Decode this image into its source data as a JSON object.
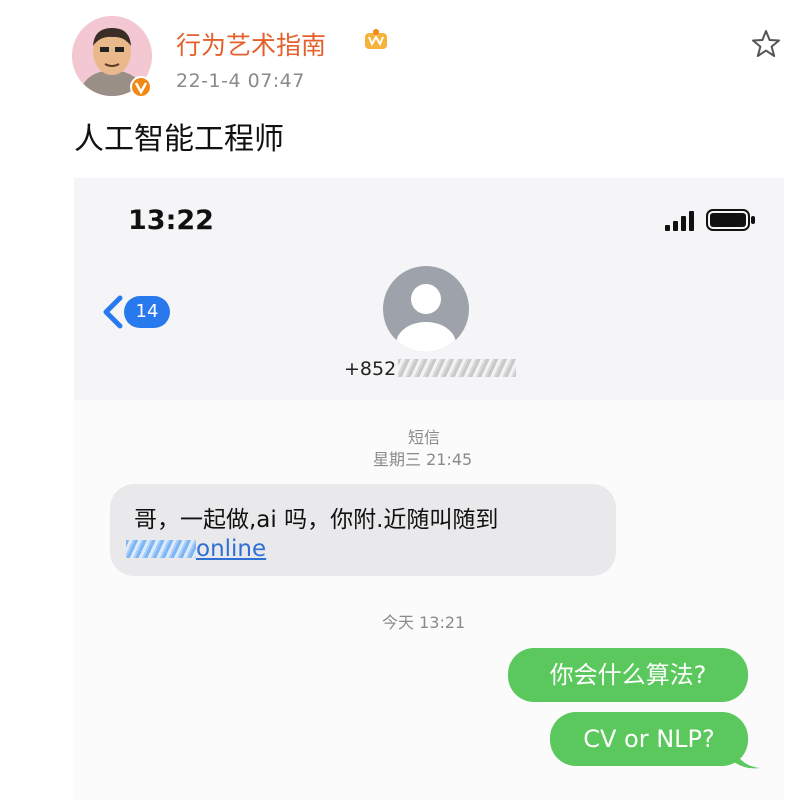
{
  "post": {
    "username": "行为艺术指南",
    "timestamp": "22-1-4 07:47",
    "text": "人工智能工程师"
  },
  "phone": {
    "clock": "13:22",
    "back_count": "14",
    "contact_number": "+852",
    "message_type": "短信",
    "first_message_date": "星期三 21:45",
    "incoming_message": {
      "line1": "哥，一起做,ai 吗，你附.近随叫随到",
      "link_suffix": "online"
    },
    "second_message_date": "今天 13:21",
    "outgoing_messages": [
      "你会什么算法?",
      "CV or NLP?"
    ]
  },
  "colors": {
    "username": "#e4612c",
    "outgoing_bubble": "#5ac85c",
    "incoming_bubble": "#e9e9eb",
    "ios_blue": "#2979ee"
  },
  "icons": [
    "vip-crown-icon",
    "verified-badge-icon",
    "favorite-star-icon",
    "cellular-signal-icon",
    "battery-icon",
    "back-chevron-icon",
    "contact-avatar-icon"
  ]
}
